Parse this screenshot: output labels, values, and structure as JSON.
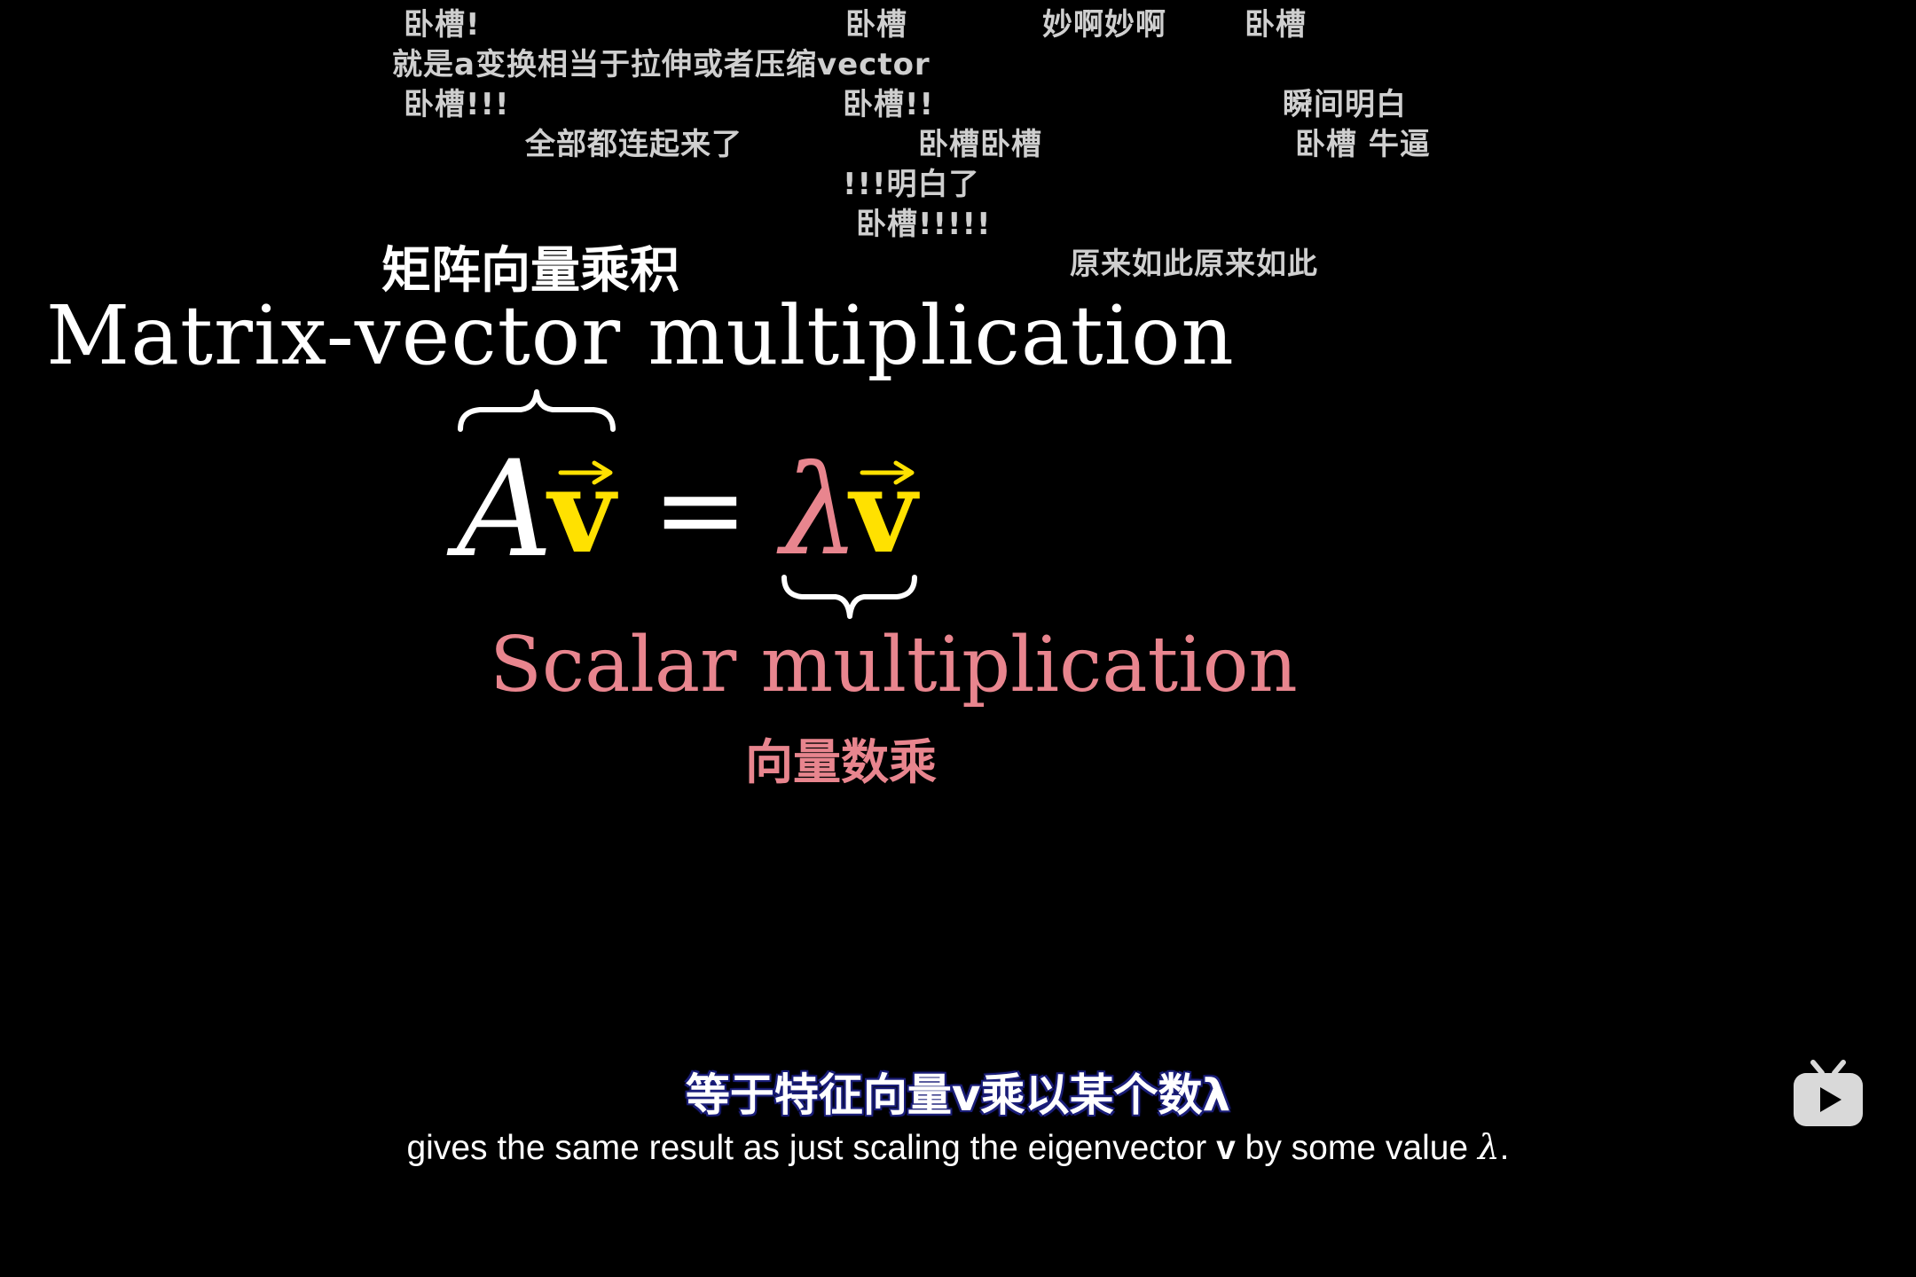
{
  "danmaku": [
    {
      "text": "卧槽!"
    },
    {
      "text": "卧槽"
    },
    {
      "text": "妙啊妙啊"
    },
    {
      "text": "卧槽"
    },
    {
      "text": "就是a变换相当于拉伸或者压缩vector"
    },
    {
      "text": "卧槽!!!"
    },
    {
      "text": "卧槽!!"
    },
    {
      "text": "瞬间明白"
    },
    {
      "text": "全部都连起来了"
    },
    {
      "text": "卧槽卧槽"
    },
    {
      "text": "卧槽 牛逼"
    },
    {
      "text": "!!!明白了"
    },
    {
      "text": "卧槽!!!!!"
    },
    {
      "text": "原来如此原来如此"
    }
  ],
  "labels": {
    "matrix_cn": "矩阵向量乘积",
    "matrix_en": "Matrix-vector multiplication",
    "scalar_en": "Scalar multiplication",
    "scalar_cn": "向量数乘"
  },
  "equation": {
    "A": "A",
    "v": "v",
    "equals": "=",
    "lambda": "λ"
  },
  "subtitles": {
    "cn": "等于特征向量v乘以某个数λ",
    "en_before": "gives the same result as just scaling the eigenvector ",
    "en_bold": "v",
    "en_middle": " by some value ",
    "en_italic": "λ",
    "en_after": "."
  },
  "colors": {
    "background": "#000000",
    "vector": "#ffe100",
    "scalar": "#e8858e",
    "danmaku": "#cfcfcf"
  },
  "icons": {
    "watermark": "bilibili-tv-icon"
  }
}
